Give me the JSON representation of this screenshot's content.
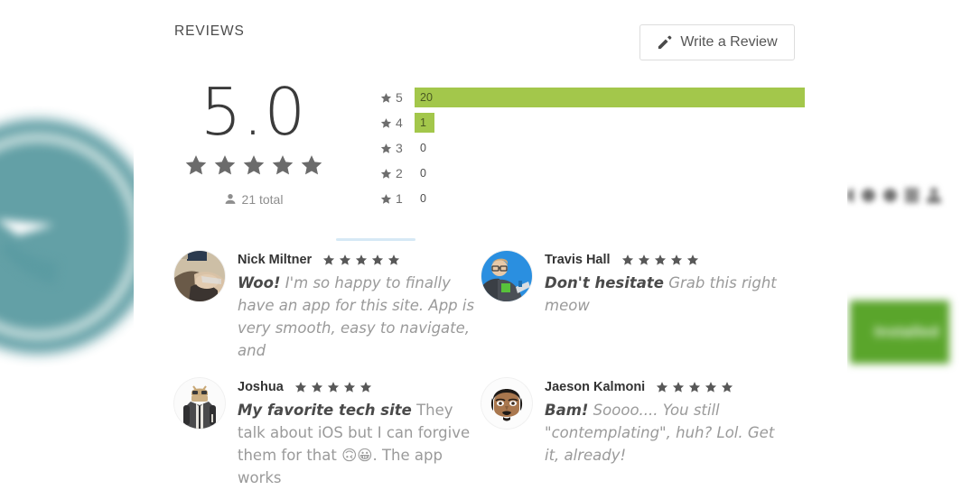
{
  "section": {
    "title": "REVIEWS"
  },
  "write_review_button": {
    "label": "Write a Review",
    "icon": "pencil-icon"
  },
  "rating_summary": {
    "score": "5.0",
    "stars_filled": 5,
    "total_label": "21 total",
    "total_icon": "person-icon",
    "bar_color": "#a3c74b",
    "histogram": [
      {
        "stars": "5",
        "count": "20",
        "percent": 100
      },
      {
        "stars": "4",
        "count": "1",
        "percent": 5
      },
      {
        "stars": "3",
        "count": "0",
        "percent": 0
      },
      {
        "stars": "2",
        "count": "0",
        "percent": 0
      },
      {
        "stars": "1",
        "count": "0",
        "percent": 0
      }
    ]
  },
  "reviews": [
    {
      "name": "Nick Miltner",
      "stars": 5,
      "headline": "Woo!",
      "text": " I'm so happy to finally have an app for this site. App is very smooth, easy to navigate, and",
      "avatar": "photo-avatar-nick"
    },
    {
      "name": "Travis Hall",
      "stars": 5,
      "headline": "Don't hesitate",
      "text": " Grab this right meow",
      "avatar": "photo-avatar-travis"
    },
    {
      "name": "Joshua",
      "stars": 5,
      "headline": "My favorite tech site",
      "text": " They talk about iOS but I can forgive them for that 🙃😀. The app works",
      "avatar": "android-avatar-joshua"
    },
    {
      "name": "Jaeson Kalmoni",
      "stars": 5,
      "headline": "Bam!",
      "text": " Soooo.... You still \"contemplating\", huh? Lol. Get it, already!",
      "avatar": "cartoon-avatar-jaeson"
    }
  ],
  "background": {
    "install_button_label": "Installed",
    "install_button_color": "#5aa52b",
    "logo_color": "#5b9ba2",
    "next_arrow_icon": "chevron-right-icon"
  }
}
